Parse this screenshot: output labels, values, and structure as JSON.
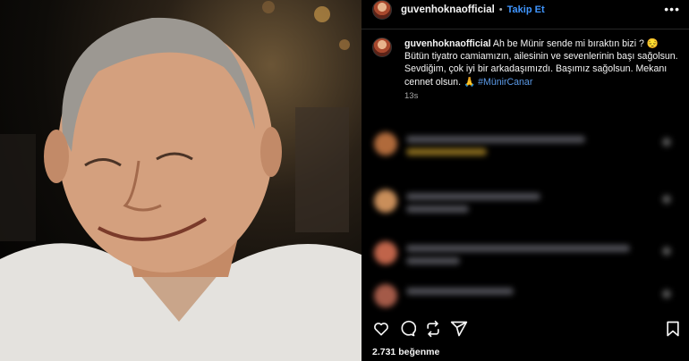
{
  "post": {
    "username": "guvenhoknaofficial",
    "separator": "•",
    "follow_label": "Takip Et",
    "more_icon": "more-horizontal-icon",
    "caption_user": "guvenhoknaofficial",
    "caption_text": " Ah be Münir sende mi bıraktın bizi ? 😔 Bütün tiyatro camiamızın, ailesinin ve sevenlerinin başı sağolsun. Sevdiğim, çok iyi bir arkadaşımızdı. Başımız sağolsun. Mekanı cennet olsun. 🙏 ",
    "hashtag": "#MünirCanar",
    "time": "13s",
    "likes": "2.731 beğenme"
  },
  "actions": [
    "heart-icon",
    "comment-icon",
    "repost-icon",
    "share-icon",
    "bookmark-icon"
  ],
  "colors": {
    "background": "#000000",
    "link": "#4096ff",
    "muted": "#a8a8a8"
  }
}
